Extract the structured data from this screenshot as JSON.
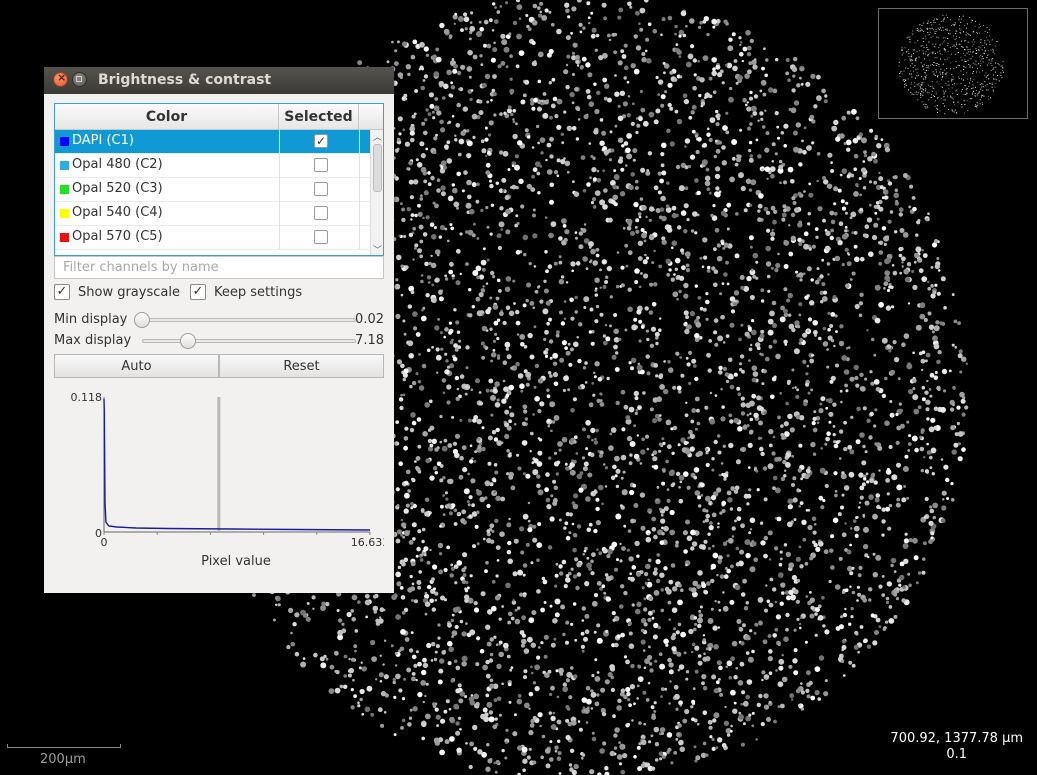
{
  "window": {
    "title": "Brightness & contrast",
    "close_glyph": "×"
  },
  "table": {
    "headers": {
      "color": "Color",
      "selected": "Selected"
    },
    "channels": [
      {
        "name": "DAPI (C1)",
        "color": "#0000ff",
        "selected": true
      },
      {
        "name": "Opal 480 (C2)",
        "color": "#2eaee0",
        "selected": false
      },
      {
        "name": "Opal 520 (C3)",
        "color": "#22e022",
        "selected": false
      },
      {
        "name": "Opal 540 (C4)",
        "color": "#ffff00",
        "selected": false
      },
      {
        "name": "Opal 570 (C5)",
        "color": "#ee1010",
        "selected": false
      }
    ]
  },
  "filter": {
    "placeholder": "Filter channels by name"
  },
  "options": {
    "show_grayscale": {
      "label": "Show grayscale",
      "checked": true
    },
    "keep_settings": {
      "label": "Keep settings",
      "checked": true
    }
  },
  "display": {
    "min_label": "Min display",
    "min_value": "0.02",
    "max_label": "Max display",
    "max_value": "7.18",
    "range_max": 16.633
  },
  "buttons": {
    "auto": "Auto",
    "reset": "Reset"
  },
  "histogram": {
    "y_max_label": "0.118",
    "y_min_label": "0",
    "x_min_label": "0",
    "x_max_label": "16.633",
    "x_axis_label": "Pixel value",
    "y_max": 0.118,
    "x_max": 16.633,
    "max_display": 7.18,
    "line_color": "#1a1aa6"
  },
  "viewer": {
    "scalebar_label": "200µm",
    "cursor_coords": "700.92, 1377.78 µm",
    "zoom": "0.1"
  },
  "colors": {
    "selection": "#0f99d5",
    "titlebar": "#3c3b37"
  }
}
